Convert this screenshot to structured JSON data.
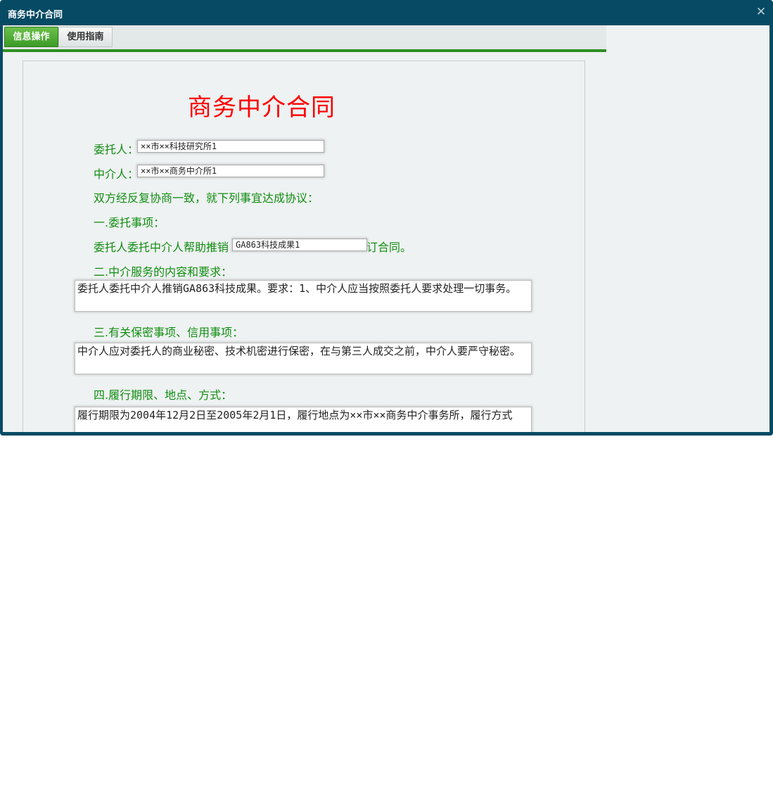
{
  "window": {
    "title": "商务中介合同",
    "close_icon": "close-icon"
  },
  "tabs": [
    {
      "label": "信息操作",
      "active": true
    },
    {
      "label": "使用指南",
      "active": false
    }
  ],
  "contract": {
    "title": "商务中介合同",
    "client_label": "委托人：",
    "client_value": "××市××科技研究所1",
    "agent_label": "中介人：",
    "agent_value": "××市××商务中介所1",
    "intro": "双方经反复协商一致，就下列事宜达成协议：",
    "section1_title": "一.委托事项：",
    "section1_prefix": "委托人委托中介人帮助推销",
    "section1_value": "GA863科技成果1",
    "section1_suffix": "订合同。",
    "section2_title": "二.中介服务的内容和要求：",
    "section2_value": "委托人委托中介人推销GA863科技成果。要求：1、中介人应当按照委托人要求处理一切事务。",
    "section3_title": "三.有关保密事项、信用事项：",
    "section3_value": "中介人应对委托人的商业秘密、技术机密进行保密，在与第三人成交之前，中介人要严守秘密。",
    "section4_title": "四.履行期限、地点、方式：",
    "section4_value": "履行期限为2004年12月2日至2005年2月1日，履行地点为××市××商务中介事务所，履行方式"
  },
  "colors": {
    "titlebar": "#064a64",
    "tab_active": "#3c9a28",
    "label_text": "#118d11",
    "doc_title": "#ff0000"
  }
}
